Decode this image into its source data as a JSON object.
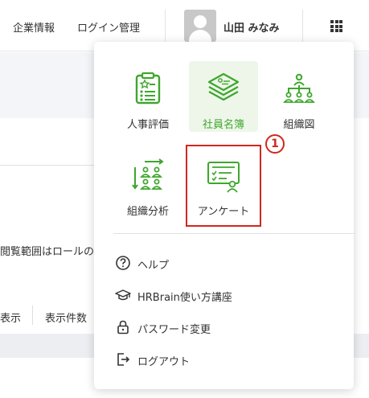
{
  "header": {
    "links": [
      "企業情報",
      "ログイン管理"
    ],
    "user_name": "山田 みなみ"
  },
  "background": {
    "text1": "閲覧範囲はロールの",
    "text2": "表示",
    "text3": "表示件数"
  },
  "apps": [
    {
      "label": "人事評価",
      "icon": "evaluation-clipboard-icon",
      "active": false
    },
    {
      "label": "社員名簿",
      "icon": "employee-directory-icon",
      "active": true
    },
    {
      "label": "組織図",
      "icon": "org-chart-icon",
      "active": false
    },
    {
      "label": "組織分析",
      "icon": "org-analysis-icon",
      "active": false
    },
    {
      "label": "アンケート",
      "icon": "survey-icon",
      "active": false
    }
  ],
  "annotation": {
    "badge": "1"
  },
  "menu": [
    {
      "label": "ヘルプ",
      "icon": "help-circle-icon"
    },
    {
      "label": "HRBrain使い方講座",
      "icon": "graduation-cap-icon"
    },
    {
      "label": "パスワード変更",
      "icon": "lock-icon"
    },
    {
      "label": "ログアウト",
      "icon": "logout-icon"
    }
  ],
  "colors": {
    "accent": "#3ea72d",
    "highlight": "#d0271f"
  }
}
